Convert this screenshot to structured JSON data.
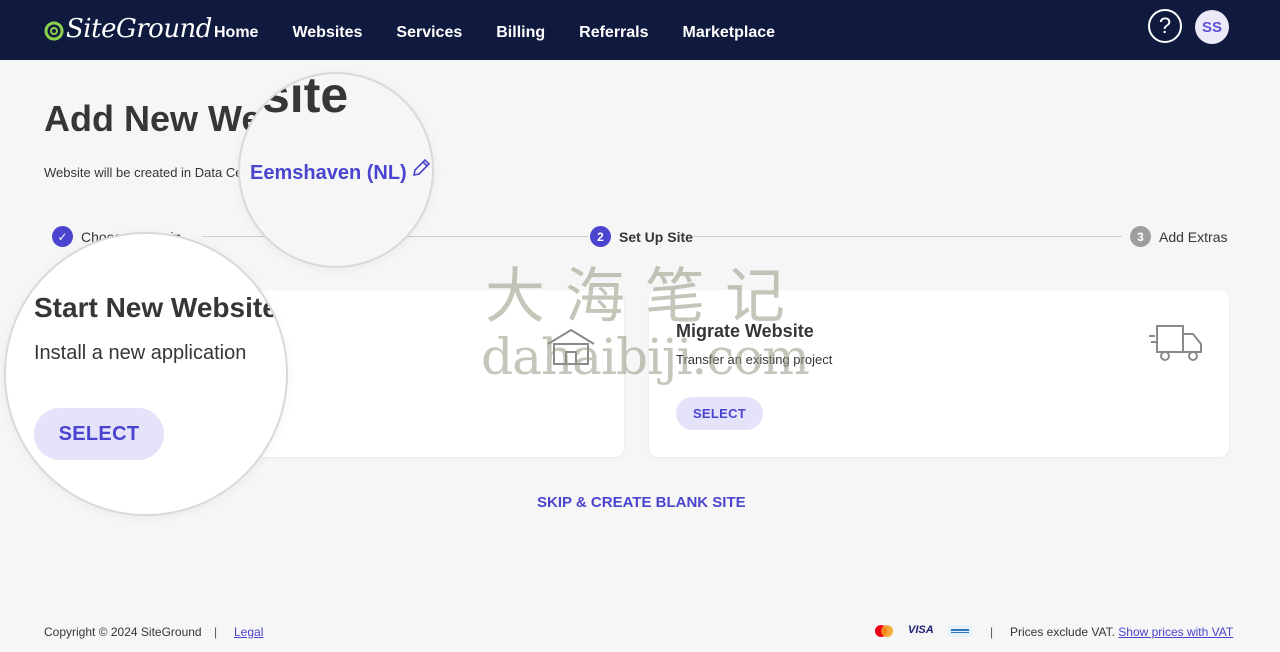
{
  "header": {
    "logo_text": "SiteGround",
    "nav": [
      "Home",
      "Websites",
      "Services",
      "Billing",
      "Referrals",
      "Marketplace"
    ],
    "help_label": "?",
    "avatar_initials": "SS"
  },
  "page": {
    "title": "Add New Website",
    "datacenter_prefix": "Website will be created in Data Center:",
    "datacenter_name": "Eemshaven (NL)"
  },
  "stepper": {
    "steps": [
      {
        "number": "✓",
        "label": "Choose Domain",
        "state": "done"
      },
      {
        "number": "2",
        "label": "Set Up Site",
        "state": "active"
      },
      {
        "number": "3",
        "label": "Add Extras",
        "state": "pending"
      }
    ]
  },
  "cards": {
    "start": {
      "title": "Start New Website",
      "desc": "Install a new application",
      "button": "SELECT"
    },
    "migrate": {
      "title": "Migrate Website",
      "desc": "Transfer an existing project",
      "button": "SELECT"
    }
  },
  "skip_label": "SKIP & CREATE BLANK SITE",
  "lens_title_fragment": "site",
  "watermark": {
    "cn": "大海笔记",
    "en": "dahaibiji.com"
  },
  "footer": {
    "copyright": "Copyright © 2024 SiteGround",
    "divider": "|",
    "legal": "Legal",
    "visa": "VISA",
    "vat_text": "Prices exclude VAT.",
    "vat_link": "Show prices with VAT"
  },
  "colors": {
    "nav_bg": "#0f1a3e",
    "accent": "#4a44cf",
    "check": "#4a44cf",
    "pending": "#9e9e9e"
  }
}
